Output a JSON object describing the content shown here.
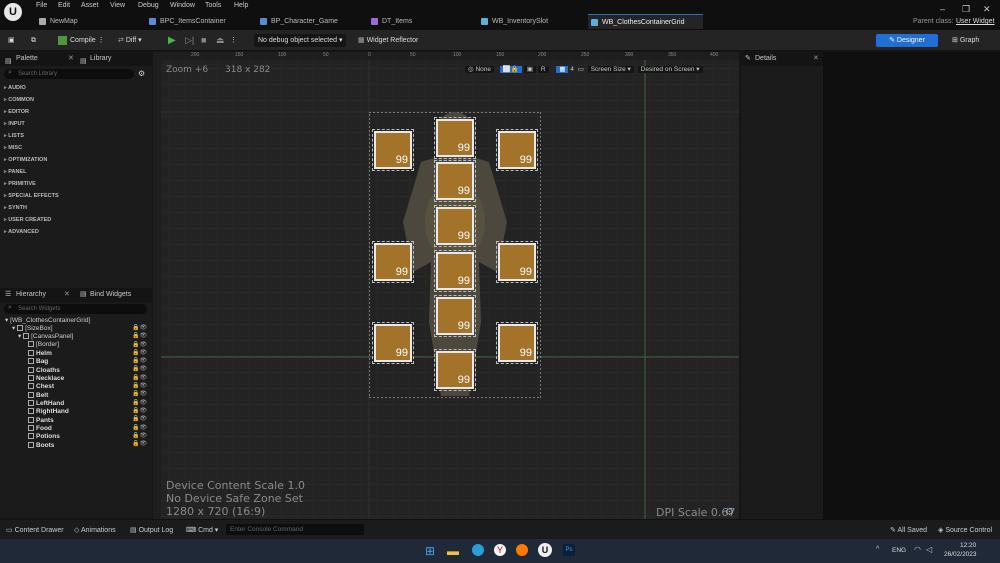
{
  "menu": [
    "File",
    "Edit",
    "Asset",
    "View",
    "Debug",
    "Window",
    "Tools",
    "Help"
  ],
  "tabs": [
    "NewMap",
    "BPC_ItemsContainer",
    "BP_Character_Game",
    "DT_Items",
    "WB_InventorySlot",
    "WB_ClothesContainerGrid"
  ],
  "parent_class_label": "Parent class:",
  "parent_class_value": "User Widget",
  "toolbar": {
    "compile": "Compile",
    "diff": "Diff",
    "debug": "No debug object selected",
    "reflector": "Widget Reflector",
    "designer": "Designer",
    "graph": "Graph"
  },
  "palette": {
    "tab1": "Palette",
    "tab2": "Library",
    "search": "Search Library",
    "categories": [
      "AUDIO",
      "COMMON",
      "EDITOR",
      "INPUT",
      "LISTS",
      "MISC",
      "OPTIMIZATION",
      "PANEL",
      "PRIMITIVE",
      "SPECIAL EFFECTS",
      "SYNTH",
      "USER CREATED",
      "ADVANCED"
    ]
  },
  "hierarchy": {
    "tab1": "Hierarchy",
    "tab2": "Bind Widgets",
    "search": "Search Widgets",
    "root": "[WB_ClothesContainerGrid]",
    "items": [
      "[SizeBox]",
      "[CanvasPanel]",
      "[Border]",
      "Helm",
      "Bag",
      "Cloaths",
      "Necklace",
      "Chest",
      "Belt",
      "LeftHand",
      "RightHand",
      "Pants",
      "Food",
      "Potions",
      "Boots"
    ]
  },
  "canvas": {
    "zoom": "Zoom +6",
    "size": "318 x 282",
    "none": "None",
    "r": "R",
    "grid": "4",
    "screen_size": "Screen Size",
    "desired": "Desired on Screen",
    "scale": "Device Content Scale 1.0",
    "safe": "No Device Safe Zone Set",
    "res": "1280 x 720 (16:9)",
    "dpi": "DPI Scale 0.67",
    "ruler_h": [
      "200",
      "150",
      "100",
      "50",
      "0",
      "50",
      "100",
      "150",
      "200",
      "250",
      "300",
      "350",
      "400"
    ],
    "slot_value": "99"
  },
  "details": "Details",
  "bottom": {
    "drawer": "Content Drawer",
    "anim": "Animations",
    "output": "Output Log",
    "cmd": "Cmd",
    "console": "Enter Console Command",
    "saved": "All Saved",
    "source": "Source Control"
  },
  "taskbar": {
    "lang": "ENG",
    "time": "12:20",
    "date": "26/02/2023"
  }
}
